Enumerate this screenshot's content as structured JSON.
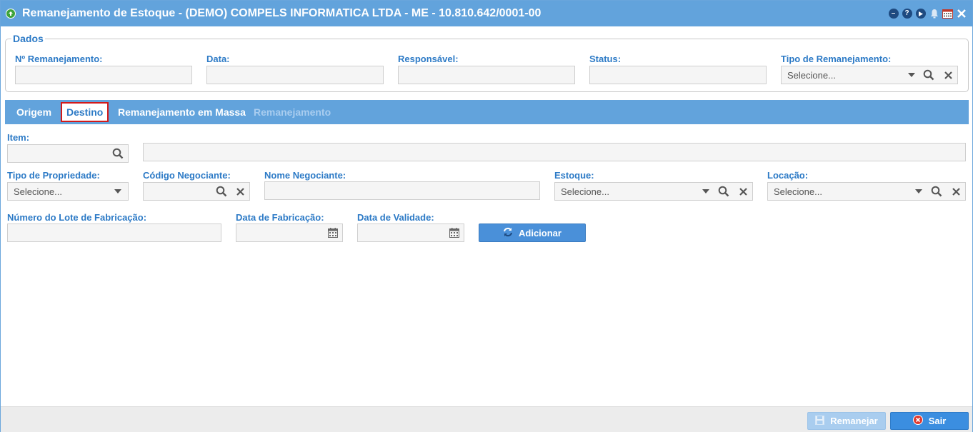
{
  "window": {
    "title": "Remanejamento de Estoque - (DEMO) COMPELS INFORMATICA LTDA - ME - 10.810.642/0001-00",
    "icons": [
      "minimize-icon",
      "help-icon",
      "play-icon",
      "bell-icon",
      "calendar-icon",
      "close-icon"
    ]
  },
  "dados": {
    "legend": "Dados",
    "fields": {
      "numero": {
        "label": "Nº Remanejamento:",
        "value": ""
      },
      "data": {
        "label": "Data:",
        "value": ""
      },
      "responsavel": {
        "label": "Responsável:",
        "value": ""
      },
      "status": {
        "label": "Status:",
        "value": ""
      },
      "tipo": {
        "label": "Tipo de Remanejamento:",
        "placeholder": "Selecione..."
      }
    }
  },
  "tabs": [
    {
      "label": "Origem",
      "state": "normal"
    },
    {
      "label": "Destino",
      "state": "active"
    },
    {
      "label": "Remanejamento em Massa",
      "state": "normal"
    },
    {
      "label": "Remanejamento",
      "state": "disabled"
    }
  ],
  "destino": {
    "item": {
      "label": "Item:",
      "code": "",
      "description": ""
    },
    "tipo_propriedade": {
      "label": "Tipo de Propriedade:",
      "placeholder": "Selecione..."
    },
    "codigo_negociante": {
      "label": "Código Negociante:",
      "value": ""
    },
    "nome_negociante": {
      "label": "Nome Negociante:",
      "value": ""
    },
    "estoque": {
      "label": "Estoque:",
      "placeholder": "Selecione..."
    },
    "locacao": {
      "label": "Locação:",
      "placeholder": "Selecione..."
    },
    "numero_lote": {
      "label": "Número do Lote de Fabricação:",
      "value": ""
    },
    "data_fabricacao": {
      "label": "Data de Fabricação:",
      "value": ""
    },
    "data_validade": {
      "label": "Data de Validade:",
      "value": ""
    },
    "add_button": "Adicionar"
  },
  "footer": {
    "remanejar": "Remanejar",
    "sair": "Sair"
  },
  "colors": {
    "header": "#62a3dc",
    "label": "#2c7ac6",
    "active_tab_border": "#d21a1a",
    "button_primary": "#3b8ee0",
    "button_disabled": "#a9cdef"
  }
}
